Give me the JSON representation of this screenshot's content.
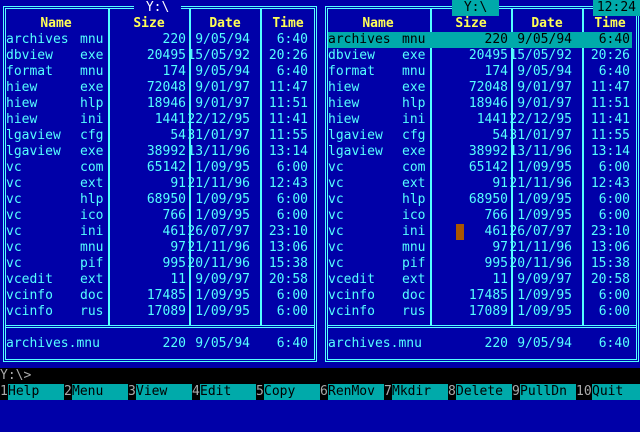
{
  "left_panel": {
    "title": " Y:\\ ",
    "headers": {
      "name": "Name",
      "size": "Size",
      "date": "Date",
      "time": "Time"
    },
    "files": [
      {
        "name": "archives",
        "ext": "mnu",
        "size": "220",
        "date": "9/05/94",
        "time": "6:40"
      },
      {
        "name": "dbview",
        "ext": "exe",
        "size": "20495",
        "date": "15/05/92",
        "time": "20:26"
      },
      {
        "name": "format",
        "ext": "mnu",
        "size": "174",
        "date": "9/05/94",
        "time": "6:40"
      },
      {
        "name": "hiew",
        "ext": "exe",
        "size": "72048",
        "date": "9/01/97",
        "time": "11:47"
      },
      {
        "name": "hiew",
        "ext": "hlp",
        "size": "18946",
        "date": "9/01/97",
        "time": "11:51"
      },
      {
        "name": "hiew",
        "ext": "ini",
        "size": "1441",
        "date": "22/12/95",
        "time": "11:41"
      },
      {
        "name": "lgaview",
        "ext": "cfg",
        "size": "54",
        "date": "31/01/97",
        "time": "11:55"
      },
      {
        "name": "lgaview",
        "ext": "exe",
        "size": "38992",
        "date": "13/11/96",
        "time": "13:14"
      },
      {
        "name": "vc",
        "ext": "com",
        "size": "65142",
        "date": "1/09/95",
        "time": "6:00"
      },
      {
        "name": "vc",
        "ext": "ext",
        "size": "91",
        "date": "21/11/96",
        "time": "12:43"
      },
      {
        "name": "vc",
        "ext": "hlp",
        "size": "68950",
        "date": "1/09/95",
        "time": "6:00"
      },
      {
        "name": "vc",
        "ext": "ico",
        "size": "766",
        "date": "1/09/95",
        "time": "6:00"
      },
      {
        "name": "vc",
        "ext": "ini",
        "size": "461",
        "date": "26/07/97",
        "time": "23:10"
      },
      {
        "name": "vc",
        "ext": "mnu",
        "size": "97",
        "date": "21/11/96",
        "time": "13:06"
      },
      {
        "name": "vc",
        "ext": "pif",
        "size": "995",
        "date": "20/11/96",
        "time": "15:38"
      },
      {
        "name": "vcedit",
        "ext": "ext",
        "size": "11",
        "date": "9/09/97",
        "time": "20:58"
      },
      {
        "name": "vcinfo",
        "ext": "doc",
        "size": "17485",
        "date": "1/09/95",
        "time": "6:00"
      },
      {
        "name": "vcinfo",
        "ext": "rus",
        "size": "17089",
        "date": "1/09/95",
        "time": "6:00"
      }
    ],
    "status": {
      "name": "archives.mnu",
      "size": "220",
      "date": "9/05/94",
      "time": "6:40"
    }
  },
  "right_panel": {
    "title": " Y:\\ ",
    "clock": "12:24",
    "headers": {
      "name": "Name",
      "size": "Size",
      "date": "Date",
      "time": "Time"
    },
    "files": [
      {
        "name": "archives",
        "ext": "mnu",
        "size": "220",
        "date": "9/05/94",
        "time": "6:40"
      },
      {
        "name": "dbview",
        "ext": "exe",
        "size": "20495",
        "date": "15/05/92",
        "time": "20:26"
      },
      {
        "name": "format",
        "ext": "mnu",
        "size": "174",
        "date": "9/05/94",
        "time": "6:40"
      },
      {
        "name": "hiew",
        "ext": "exe",
        "size": "72048",
        "date": "9/01/97",
        "time": "11:47"
      },
      {
        "name": "hiew",
        "ext": "hlp",
        "size": "18946",
        "date": "9/01/97",
        "time": "11:51"
      },
      {
        "name": "hiew",
        "ext": "ini",
        "size": "1441",
        "date": "22/12/95",
        "time": "11:41"
      },
      {
        "name": "lgaview",
        "ext": "cfg",
        "size": "54",
        "date": "31/01/97",
        "time": "11:55"
      },
      {
        "name": "lgaview",
        "ext": "exe",
        "size": "38992",
        "date": "13/11/96",
        "time": "13:14"
      },
      {
        "name": "vc",
        "ext": "com",
        "size": "65142",
        "date": "1/09/95",
        "time": "6:00"
      },
      {
        "name": "vc",
        "ext": "ext",
        "size": "91",
        "date": "21/11/96",
        "time": "12:43"
      },
      {
        "name": "vc",
        "ext": "hlp",
        "size": "68950",
        "date": "1/09/95",
        "time": "6:00"
      },
      {
        "name": "vc",
        "ext": "ico",
        "size": "766",
        "date": "1/09/95",
        "time": "6:00"
      },
      {
        "name": "vc",
        "ext": "ini",
        "size": "461",
        "date": "26/07/97",
        "time": "23:10"
      },
      {
        "name": "vc",
        "ext": "mnu",
        "size": "97",
        "date": "21/11/96",
        "time": "13:06"
      },
      {
        "name": "vc",
        "ext": "pif",
        "size": "995",
        "date": "20/11/96",
        "time": "15:38"
      },
      {
        "name": "vcedit",
        "ext": "ext",
        "size": "11",
        "date": "9/09/97",
        "time": "20:58"
      },
      {
        "name": "vcinfo",
        "ext": "doc",
        "size": "17485",
        "date": "1/09/95",
        "time": "6:00"
      },
      {
        "name": "vcinfo",
        "ext": "rus",
        "size": "17089",
        "date": "1/09/95",
        "time": "6:00"
      }
    ],
    "status": {
      "name": "archives.mnu",
      "size": "220",
      "date": "9/05/94",
      "time": "6:40"
    }
  },
  "command_line": "Y:\\>",
  "function_keys": [
    {
      "num": "1",
      "label": "Help"
    },
    {
      "num": "2",
      "label": "Menu"
    },
    {
      "num": "3",
      "label": "View"
    },
    {
      "num": "4",
      "label": "Edit"
    },
    {
      "num": "5",
      "label": "Copy"
    },
    {
      "num": "6",
      "label": "RenMov"
    },
    {
      "num": "7",
      "label": "Mkdir"
    },
    {
      "num": "8",
      "label": "Delete"
    },
    {
      "num": "9",
      "label": "PullDn"
    },
    {
      "num": "10",
      "label": "Quit"
    }
  ],
  "colors": {
    "background": "#0000a8",
    "text": "#55ffff",
    "header": "#ffff55",
    "highlight": "#00aaaa"
  }
}
